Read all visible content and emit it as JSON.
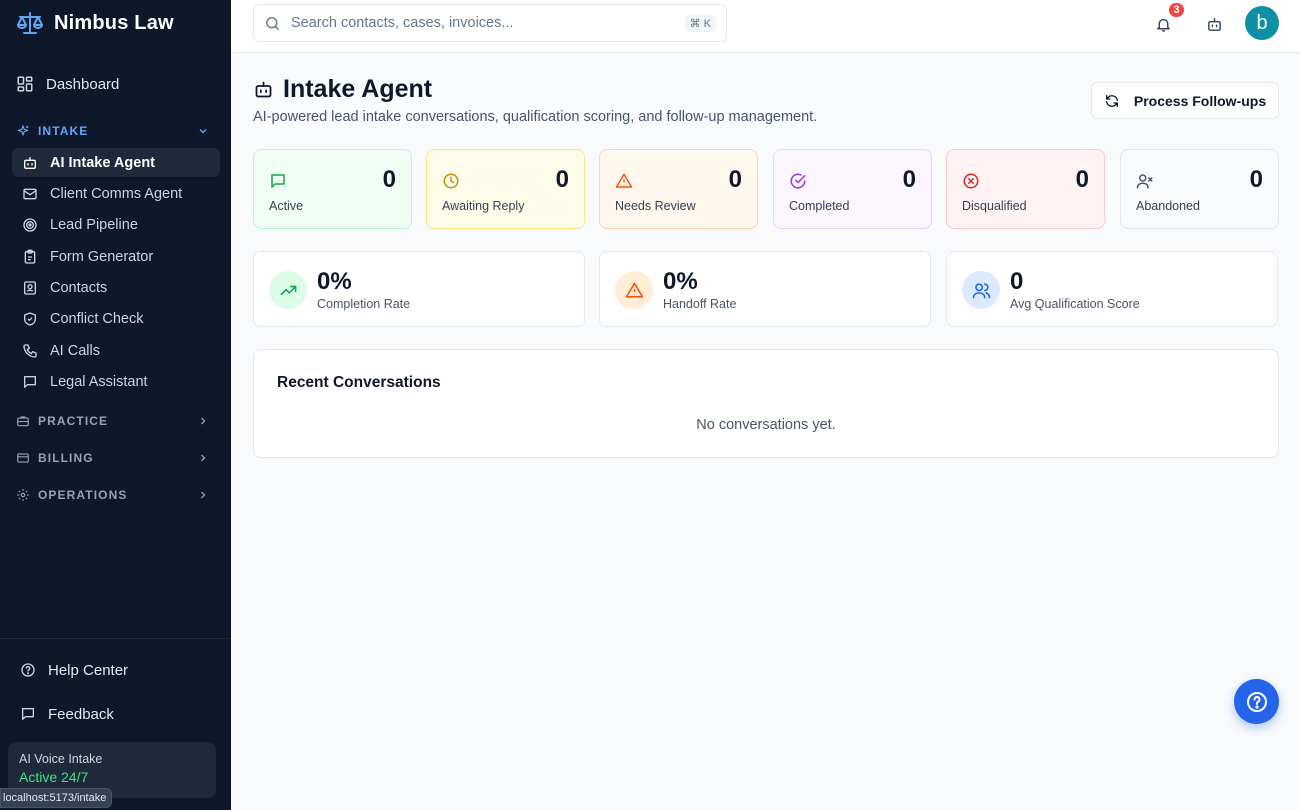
{
  "brand": {
    "name": "Nimbus Law"
  },
  "sidebar": {
    "dashboard": "Dashboard",
    "intake_section": "INTAKE",
    "intake_items": [
      {
        "label": "AI Intake Agent",
        "icon": "bot-icon",
        "active": true
      },
      {
        "label": "Client Comms Agent",
        "icon": "mail-icon"
      },
      {
        "label": "Lead Pipeline",
        "icon": "target-icon"
      },
      {
        "label": "Form Generator",
        "icon": "clipboard-icon"
      },
      {
        "label": "Contacts",
        "icon": "contact-card-icon"
      },
      {
        "label": "Conflict Check",
        "icon": "shield-icon"
      },
      {
        "label": "AI Calls",
        "icon": "phone-icon"
      },
      {
        "label": "Legal Assistant",
        "icon": "chat-icon"
      }
    ],
    "practice_section": "PRACTICE",
    "billing_section": "BILLING",
    "operations_section": "OPERATIONS",
    "help_center": "Help Center",
    "feedback": "Feedback",
    "voice_card": {
      "title": "AI Voice Intake",
      "status": "Active 24/7"
    },
    "url_hint": "localhost:5173/intake"
  },
  "topbar": {
    "search_placeholder": "Search contacts, cases, invoices...",
    "shortcut": "⌘ K",
    "notification_count": "3",
    "avatar_letter": "b"
  },
  "main": {
    "title": "Intake Agent",
    "subtitle": "AI-powered lead intake conversations, qualification scoring, and follow-up management.",
    "process_button": "Process Follow-ups",
    "stats": [
      {
        "label": "Active",
        "value": "0",
        "icon": "message-square-icon"
      },
      {
        "label": "Awaiting Reply",
        "value": "0",
        "icon": "clock-icon"
      },
      {
        "label": "Needs Review",
        "value": "0",
        "icon": "alert-triangle-icon"
      },
      {
        "label": "Completed",
        "value": "0",
        "icon": "check-circle-icon"
      },
      {
        "label": "Disqualified",
        "value": "0",
        "icon": "x-circle-icon"
      },
      {
        "label": "Abandoned",
        "value": "0",
        "icon": "user-x-icon"
      }
    ],
    "metrics": [
      {
        "value": "0%",
        "label": "Completion Rate",
        "icon": "trending-up-icon"
      },
      {
        "value": "0%",
        "label": "Handoff Rate",
        "icon": "alert-triangle-icon"
      },
      {
        "value": "0",
        "label": "Avg Qualification Score",
        "icon": "users-icon"
      }
    ],
    "recent": {
      "title": "Recent Conversations",
      "empty": "No conversations yet."
    }
  },
  "colors": {
    "sidebar_bg": "#0f172a",
    "accent": "#2563eb",
    "intake_accent": "#60a5fa",
    "avatar": "#0e8fa8",
    "badge": "#ef4444"
  }
}
